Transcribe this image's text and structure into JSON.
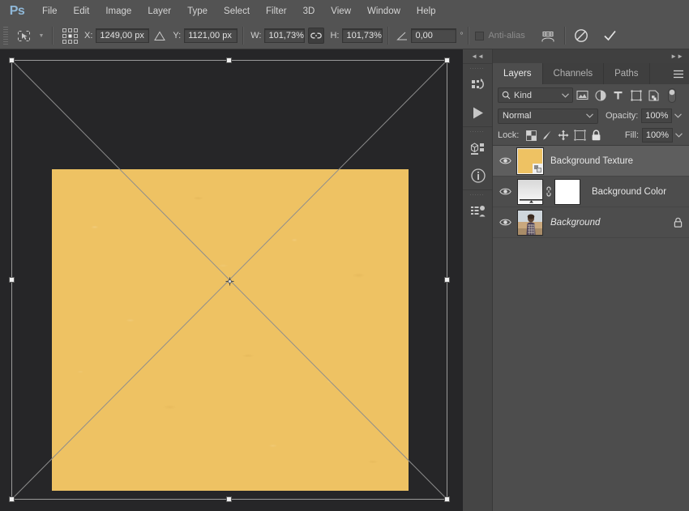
{
  "app": {
    "name": "Ps",
    "logo_color": "#8fb8d8"
  },
  "menubar": {
    "items": [
      {
        "label": "File"
      },
      {
        "label": "Edit"
      },
      {
        "label": "Image"
      },
      {
        "label": "Layer"
      },
      {
        "label": "Type"
      },
      {
        "label": "Select"
      },
      {
        "label": "Filter"
      },
      {
        "label": "3D"
      },
      {
        "label": "View"
      },
      {
        "label": "Window"
      },
      {
        "label": "Help"
      }
    ]
  },
  "options_bar": {
    "tool_icon": "free-transform-icon",
    "reference_point_icon": "reference-point-grid-icon",
    "x_label": "X:",
    "x_value": "1249,00 px",
    "delta_icon": "relative-position-icon",
    "y_label": "Y:",
    "y_value": "1121,00 px",
    "w_label": "W:",
    "w_value": "101,73%",
    "link_icon": "maintain-aspect-ratio-icon",
    "h_label": "H:",
    "h_value": "101,73%",
    "angle_icon": "rotate-angle-icon",
    "angle_value": "0,00",
    "degree_symbol": "°",
    "skew_h_label": "",
    "antialias_label": "Anti-alias",
    "antialias_checked": false,
    "warp_icon": "switch-warp-mode-icon",
    "cancel_icon": "cancel-transform-icon",
    "commit_icon": "commit-transform-icon"
  },
  "canvas": {
    "background_color": "#262628",
    "texture_color": "#eec263",
    "transform_box": {
      "handles": [
        "top-left",
        "top-middle",
        "top-right",
        "middle-left",
        "middle-right",
        "bottom-left",
        "bottom-middle",
        "bottom-right"
      ],
      "center_reference_icon": "transform-center-point-icon",
      "diagonals_visible": true
    }
  },
  "dock_rail": {
    "collapse_icon": "collapse-panels-icon",
    "buttons": [
      {
        "icon": "history-icon",
        "name": "history-panel-button"
      },
      {
        "icon": "play-icon",
        "name": "actions-panel-button"
      },
      {
        "icon": "properties-3d-icon",
        "name": "properties-panel-button"
      },
      {
        "icon": "info-icon",
        "name": "info-panel-button"
      },
      {
        "icon": "adjustments-icon",
        "name": "adjustments-panel-button"
      }
    ]
  },
  "panel": {
    "collapse_icon": "expand-panels-icon",
    "menu_icon": "panel-menu-icon",
    "tabs": [
      {
        "label": "Layers",
        "active": true
      },
      {
        "label": "Channels",
        "active": false
      },
      {
        "label": "Paths",
        "active": false
      }
    ],
    "filter": {
      "search_icon": "search-icon",
      "kind_label": "Kind",
      "caret_icon": "chevron-down-icon",
      "type_filters": [
        {
          "icon": "pixel-layer-filter-icon"
        },
        {
          "icon": "adjustment-layer-filter-icon"
        },
        {
          "icon": "type-layer-filter-icon"
        },
        {
          "icon": "shape-layer-filter-icon"
        },
        {
          "icon": "smart-object-filter-icon"
        }
      ],
      "toggle_icon": "filter-toggle-icon"
    },
    "blend": {
      "mode": "Normal",
      "mode_caret_icon": "chevron-down-icon",
      "opacity_label": "Opacity:",
      "opacity_value": "100%",
      "opacity_caret_icon": "chevron-down-icon"
    },
    "lock": {
      "label": "Lock:",
      "icons": [
        {
          "icon": "lock-transparent-pixels-icon"
        },
        {
          "icon": "lock-image-pixels-icon"
        },
        {
          "icon": "lock-position-icon"
        },
        {
          "icon": "lock-artboard-nesting-icon"
        },
        {
          "icon": "lock-all-icon"
        }
      ],
      "fill_label": "Fill:",
      "fill_value": "100%",
      "fill_caret_icon": "chevron-down-icon"
    },
    "layers": [
      {
        "name": "Background Texture",
        "visible": true,
        "selected": true,
        "thumb_type": "smart-object-texture",
        "thumb_color": "#eec263",
        "badge_icon": "smart-object-badge-icon",
        "locked": false,
        "italic": false,
        "has_mask": false
      },
      {
        "name": "Background Color",
        "visible": true,
        "selected": false,
        "thumb_type": "adjustment",
        "link_icon": "mask-link-icon",
        "locked": false,
        "italic": false,
        "has_mask": true,
        "mask_color": "#ffffff"
      },
      {
        "name": "Background",
        "visible": true,
        "selected": false,
        "thumb_type": "photo",
        "lock_icon": "locked-layer-icon",
        "locked": true,
        "italic": true,
        "has_mask": false
      }
    ],
    "visibility_icon": "eye-icon"
  }
}
